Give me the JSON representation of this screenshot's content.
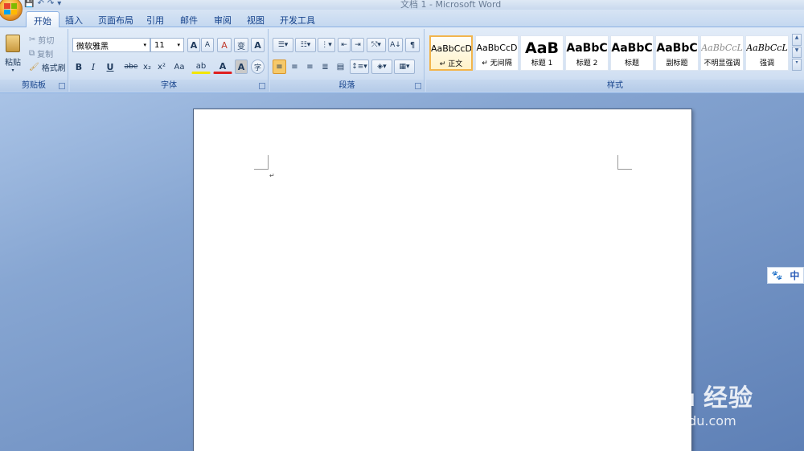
{
  "window": {
    "title": "文档 1 - Microsoft Word"
  },
  "quick_access": {
    "save": "💾",
    "undo": "↶",
    "redo": "↷",
    "more": "▾"
  },
  "tabs": [
    {
      "label": "开始"
    },
    {
      "label": "插入"
    },
    {
      "label": "页面布局"
    },
    {
      "label": "引用"
    },
    {
      "label": "邮件"
    },
    {
      "label": "审阅"
    },
    {
      "label": "视图"
    },
    {
      "label": "开发工具"
    }
  ],
  "clipboard": {
    "paste": "粘贴",
    "cut": "剪切",
    "copy": "复制",
    "format_painter": "格式刷",
    "group": "剪贴板"
  },
  "font": {
    "family": "微软雅黑",
    "size": "11",
    "group": "字体",
    "grow": "A",
    "shrink": "A",
    "clear": "A",
    "phonetic": "变",
    "border": "A",
    "bold": "B",
    "italic": "I",
    "underline": "U",
    "strike": "abe",
    "subscript": "x₂",
    "superscript": "x²",
    "case": "Aa",
    "highlight": "ab",
    "color": "A",
    "shading": "A",
    "enclose": "字"
  },
  "paragraph": {
    "group": "段落"
  },
  "styles": {
    "group": "样式",
    "items": [
      {
        "preview": "AaBbCcD",
        "name": "↵ 正文"
      },
      {
        "preview": "AaBbCcD",
        "name": "↵ 无间隔"
      },
      {
        "preview": "AaB",
        "name": "标题 1"
      },
      {
        "preview": "AaBbC",
        "name": "标题 2"
      },
      {
        "preview": "AaBbC",
        "name": "标题"
      },
      {
        "preview": "AaBbC",
        "name": "副标题"
      },
      {
        "preview": "AaBbCcL",
        "name": "不明显强调"
      },
      {
        "preview": "AaBbCcL",
        "name": "强调"
      }
    ]
  },
  "document": {
    "paragraph_mark": "↵"
  },
  "ime": {
    "icon": "🐾",
    "label": "中"
  },
  "watermark": {
    "brand": "Bai du 经验",
    "url": "jingyan.baidu.com"
  },
  "colors": {
    "accent": "#15428b",
    "ribbon": "#d3e1f3",
    "selected_style": "#f2b54c"
  }
}
